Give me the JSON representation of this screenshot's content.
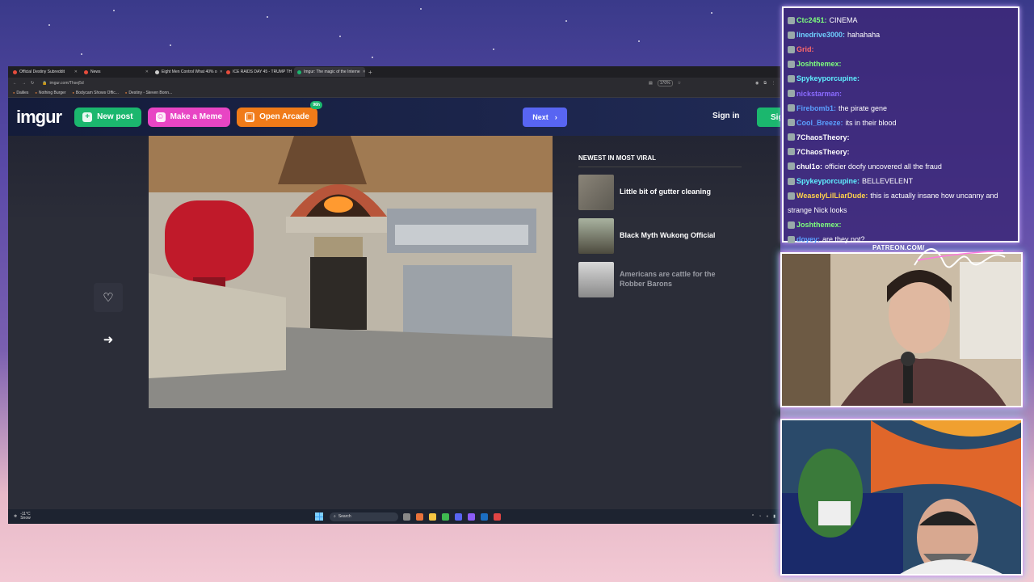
{
  "browser": {
    "tabs": [
      {
        "label": "Official Destiny Subreddit",
        "active": false
      },
      {
        "label": "News",
        "active": false
      },
      {
        "label": "Eight Men Control What 40% o",
        "active": false
      },
      {
        "label": "ICE RAIDS DAY 45 - TRUMP TH",
        "active": false
      },
      {
        "label": "Imgur: The magic of the Interne",
        "active": true
      }
    ],
    "url": "imgur.com/Thsej5d",
    "zoom": "170%",
    "bookmarks": [
      "Dailies",
      "Nothing Burger",
      "Bodycam Shows Offic...",
      "Destiny - Steven Bonn..."
    ]
  },
  "imgur": {
    "logo": "imgur",
    "new_post": "New post",
    "make_meme": "Make a Meme",
    "open_arcade": "Open Arcade",
    "arcade_badge": "96h",
    "next": "Next",
    "sign_in": "Sign in",
    "sign_up": "Sig",
    "viral_title": "NEWEST IN MOST VIRAL",
    "viral_items": [
      {
        "title": "Little bit of gutter cleaning"
      },
      {
        "title": "Black Myth Wukong Official"
      },
      {
        "title": "Americans are cattle for the Robber Barons"
      }
    ]
  },
  "taskbar": {
    "temp": "-11°C",
    "weather": "Snow",
    "search": "Search"
  },
  "chat": [
    {
      "user": "Ctc2451:",
      "color": "#7dff7d",
      "text": "CINEMA"
    },
    {
      "user": "linedrive3000:",
      "color": "#6fd0ff",
      "text": "hahahaha"
    },
    {
      "user": "Grid:",
      "color": "#ff6a6a",
      "text": ""
    },
    {
      "user": "Joshthemex:",
      "color": "#7dff7d",
      "text": ""
    },
    {
      "user": "Spykeyporcupine:",
      "color": "#5ff0ff",
      "text": ""
    },
    {
      "user": "nickstarman:",
      "color": "#8a6bff",
      "text": ""
    },
    {
      "user": "Firebomb1:",
      "color": "#5aa0ff",
      "text": "the pirate gene"
    },
    {
      "user": "Cool_Breeze:",
      "color": "#5aa0ff",
      "text": "its in their blood"
    },
    {
      "user": "7ChaosTheory:",
      "color": "#ffffff",
      "text": ""
    },
    {
      "user": "7ChaosTheory:",
      "color": "#ffffff",
      "text": ""
    },
    {
      "user": "chul1o:",
      "color": "#ffffff",
      "text": "officier doofy uncovered all the fraud"
    },
    {
      "user": "Spykeyporcupine:",
      "color": "#5ff0ff",
      "text": "BELLEVELENT"
    },
    {
      "user": "WeaselyLilLiarDude:",
      "color": "#ffd24a",
      "text": "this is actually insane how uncanny and"
    },
    {
      "user": "",
      "color": "#ffffff",
      "text": "strange Nick looks"
    },
    {
      "user": "Joshthemex:",
      "color": "#7dff7d",
      "text": ""
    },
    {
      "user": "doyey:",
      "color": "#5aa0ff",
      "text": "are they not?"
    }
  ],
  "overlay": {
    "patreon": "PATREON.COM/",
    "signature": "Anything Else?"
  }
}
